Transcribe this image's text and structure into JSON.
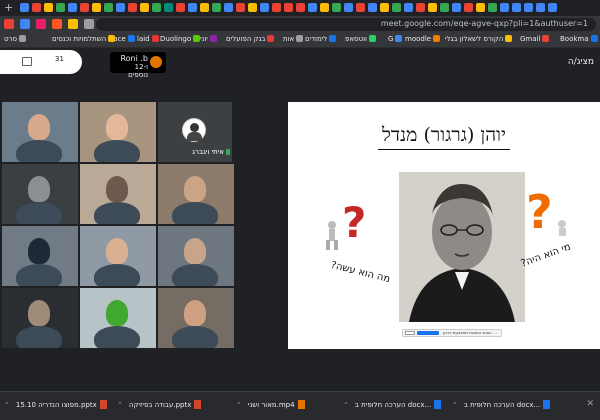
{
  "browser": {
    "new_tab_icon": "+",
    "url": "meet.google.com/eqe-agve-qxp?pli=1&authuser=1",
    "tab_favicon_colors": [
      "#4285f4",
      "#ea4335",
      "#fbbc05",
      "#34a853",
      "#4285f4",
      "#ea4335",
      "#fbbc05",
      "#34a853",
      "#4285f4",
      "#ea4335",
      "#fbbc05",
      "#34a853",
      "#00897b",
      "#ea4335",
      "#4285f4",
      "#fbbc05",
      "#34a853",
      "#4285f4",
      "#ea4335",
      "#fbbc05",
      "#4285f4",
      "#ea4335",
      "#ea4335",
      "#ea4335",
      "#4285f4",
      "#fbbc05",
      "#34a853",
      "#4285f4",
      "#ea4335",
      "#4285f4",
      "#fbbc05",
      "#34a853",
      "#4285f4",
      "#ea4335",
      "#fbbc05",
      "#34a853",
      "#4285f4",
      "#ea4335",
      "#fbbc05",
      "#34a853",
      "#4285f4",
      "#4285f4",
      "#4285f4",
      "#4285f4",
      "#4285f4"
    ]
  },
  "bookmarks": [
    {
      "label": "Bookma",
      "color": "#1a73e8"
    },
    {
      "label": "Gmail",
      "color": "#ea4335"
    },
    {
      "label": "הקורס לשאלון בגלי",
      "color": "#fbbc05"
    },
    {
      "label": "moodle",
      "color": "#f57c00"
    },
    {
      "label": "G",
      "color": "#4285f4"
    },
    {
      "label": "ווטסאפ",
      "color": "#25d366"
    },
    {
      "label": "לימודים",
      "color": "#1a73e8"
    },
    {
      "label": "אות",
      "color": "#9e9e9e"
    },
    {
      "label": "בנק הפועלים",
      "color": "#e53935"
    },
    {
      "label": "יוני",
      "color": "#8e24aa"
    },
    {
      "label": "Duolingo",
      "color": "#58cc02"
    },
    {
      "label": "laid",
      "color": "#e53935"
    },
    {
      "label": "Face",
      "color": "#1877f2"
    },
    {
      "label": "השתלמויות וכנסים",
      "color": "#fbbc05"
    },
    {
      "label": "סרט",
      "color": "#9e9e9e"
    }
  ],
  "meet": {
    "presenter_label": "מציג/ה",
    "host_name": "Roni .b",
    "host_sub": "ו-12 נוספים",
    "info_count": "31",
    "participant_name": "איתי ויגברג",
    "tiles": [
      {
        "bg": "#6b7d8a",
        "person": "#d6a98a"
      },
      {
        "bg": "#a89580",
        "person": "#e2b899"
      },
      {
        "bg": "#3a3f44",
        "person": "#8a8f94"
      },
      {
        "bg": "#b9a996",
        "person": "#6d5a4d"
      },
      {
        "bg": "#8c7a6a",
        "person": "#c9a586"
      },
      {
        "bg": "#707b86",
        "person": "#1d2a36"
      },
      {
        "bg": "#8f9aa4",
        "person": "#d9b192"
      },
      {
        "bg": "#6e7780",
        "person": "#c7a48a"
      },
      {
        "bg": "#2a2e33",
        "person": "#a08a78"
      },
      {
        "bg": "#b8c3c8",
        "person": "#40a830"
      },
      {
        "bg": "#756c63",
        "person": "#cfa182"
      },
      {
        "bg": "#5f6b72",
        "person": "#303030"
      }
    ]
  },
  "slide": {
    "title": "יוהן (גרגור) מנדל",
    "question_left": "מה הוא עשה?",
    "question_right": "מי הוא היה?",
    "bar_text": "הצגת המצגת מתבצעת כרגע ..."
  },
  "downloads": [
    {
      "label": "...docx הערכה חלופית ב",
      "color": "#1a73e8"
    },
    {
      "label": "...docx הערכה חלופית ב",
      "color": "#1a73e8"
    },
    {
      "label": "mp4.מאור ושני",
      "color": "#e37400"
    },
    {
      "label": "pptx.עבודה בפיזיקה",
      "color": "#d24726"
    },
    {
      "label": "pptx.מפוצו הנדריה 15.10",
      "color": "#d24726"
    }
  ]
}
